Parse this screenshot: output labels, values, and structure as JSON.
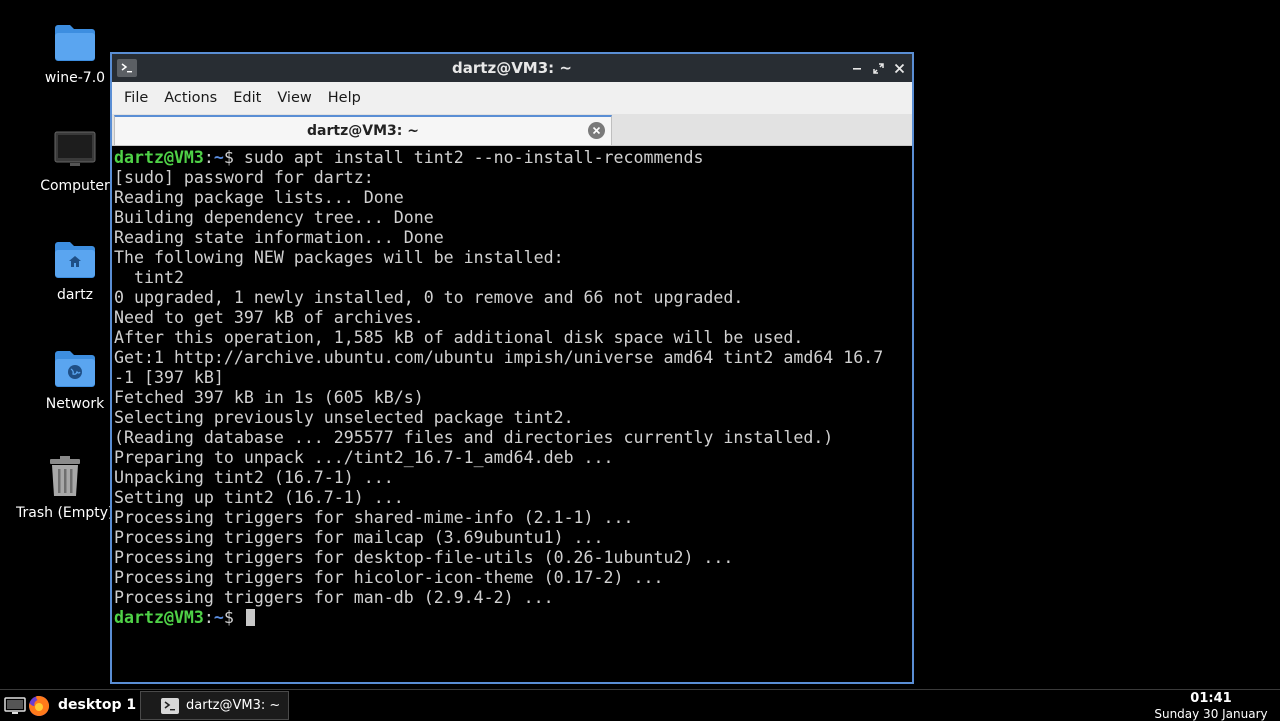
{
  "desktop": {
    "icons": [
      {
        "label": "wine-7.0",
        "icon": "folder-icon"
      },
      {
        "label": "Computer",
        "icon": "computer-icon"
      },
      {
        "label": "dartz",
        "icon": "home-folder-icon"
      },
      {
        "label": "Network",
        "icon": "network-folder-icon"
      },
      {
        "label": "Trash (Empty)",
        "icon": "trash-icon"
      }
    ]
  },
  "window": {
    "title": "dartz@VM3: ~",
    "menu": [
      "File",
      "Actions",
      "Edit",
      "View",
      "Help"
    ],
    "tab_label": "dartz@VM3: ~",
    "accent_color": "#5a8ed4"
  },
  "terminal": {
    "prompt_user": "dartz@VM3",
    "prompt_sep": ":",
    "prompt_path": "~",
    "prompt_symbol": "$ ",
    "command": "sudo apt install tint2 --no-install-recommends",
    "output": [
      "[sudo] password for dartz:",
      "Reading package lists... Done",
      "Building dependency tree... Done",
      "Reading state information... Done",
      "The following NEW packages will be installed:",
      "  tint2",
      "0 upgraded, 1 newly installed, 0 to remove and 66 not upgraded.",
      "Need to get 397 kB of archives.",
      "After this operation, 1,585 kB of additional disk space will be used.",
      "Get:1 http://archive.ubuntu.com/ubuntu impish/universe amd64 tint2 amd64 16.7",
      "-1 [397 kB]",
      "Fetched 397 kB in 1s (605 kB/s)",
      "Selecting previously unselected package tint2.",
      "(Reading database ... 295577 files and directories currently installed.)",
      "Preparing to unpack .../tint2_16.7-1_amd64.deb ...",
      "Unpacking tint2 (16.7-1) ...",
      "Setting up tint2 (16.7-1) ...",
      "Processing triggers for shared-mime-info (2.1-1) ...",
      "Processing triggers for mailcap (3.69ubuntu1) ...",
      "Processing triggers for desktop-file-utils (0.26-1ubuntu2) ...",
      "Processing triggers for hicolor-icon-theme (0.17-2) ...",
      "Processing triggers for man-db (2.9.4-2) ..."
    ]
  },
  "taskbar": {
    "desktop_label": "desktop 1",
    "task_label": "dartz@VM3: ~",
    "time": "01:41",
    "date": "Sunday 30 January"
  }
}
